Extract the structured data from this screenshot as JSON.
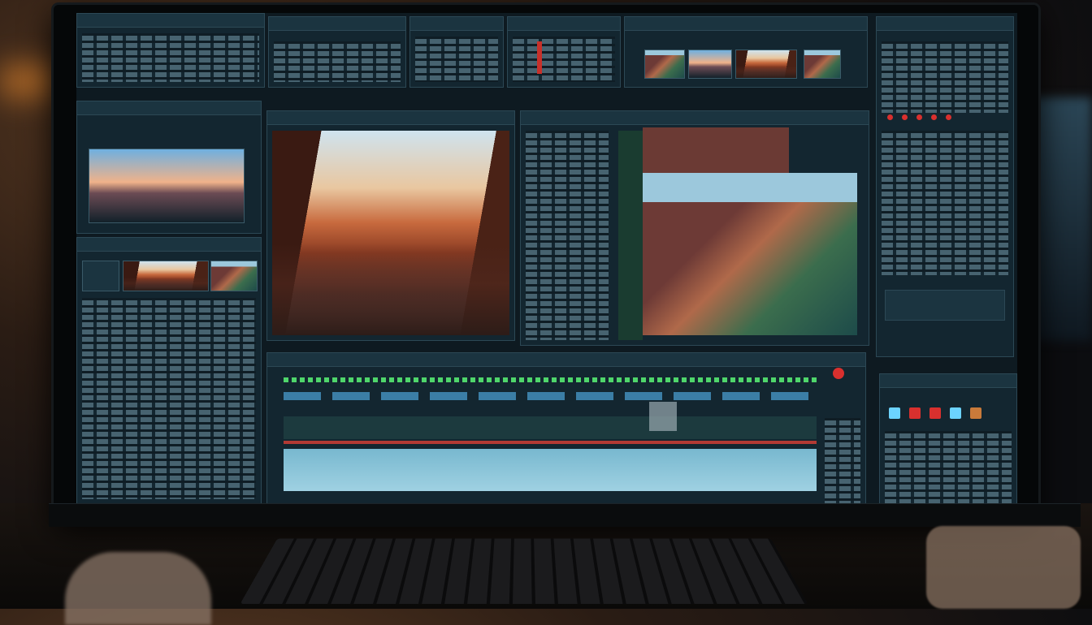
{
  "app": {
    "accent": "#6cd3ff",
    "record_color": "#d9302e",
    "panel_bg": "#132630"
  }
}
